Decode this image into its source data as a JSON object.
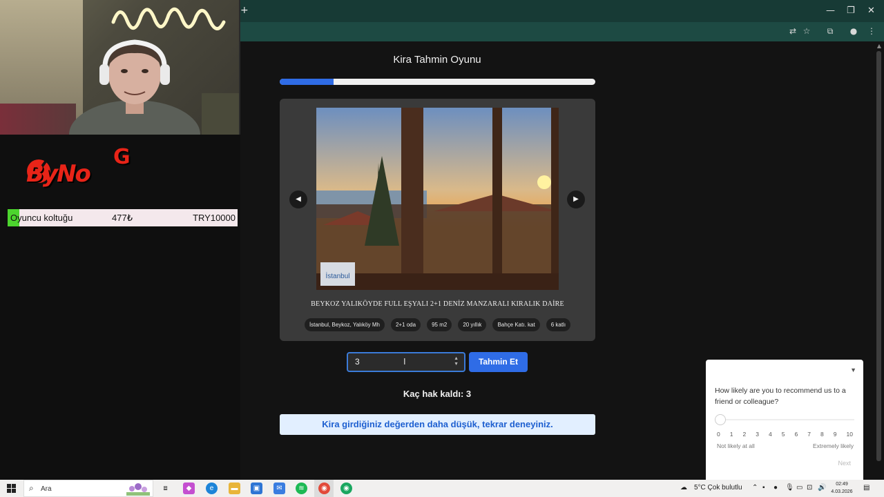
{
  "stream_overlay": {
    "logo_text": "ByNo",
    "logo_letter": "G",
    "donation": {
      "item": "Oyuncu koltuğu",
      "price": "477₺",
      "goal": "TRY10000"
    }
  },
  "game": {
    "title": "Kira Tahmin Oyunu",
    "progress_fraction": 0.17,
    "listing_title": "BEYKOZ YALIKÖYDE FULL EŞYALI 2+1 DENİZ MANZARALI KIRALIK DAİRE",
    "tags": [
      "İstanbul, Beykoz, Yalıköy Mh",
      "2+1 oda",
      "95 m2",
      "20 yıllık",
      "Bahçe Katı. kat",
      "6 katlı"
    ],
    "photo_badge": "İstanbul",
    "prev_icon": "play-left-icon",
    "next_icon": "play-right-icon",
    "guess_value": "3",
    "guess_button": "Tahmin Et",
    "remaining": "Kaç hak kaldı: 3",
    "feedback": "Kira girdiğiniz değerden daha düşük, tekrar deneyiniz."
  },
  "survey": {
    "question": "How likely are you to recommend us to a friend or colleague?",
    "scale": [
      "0",
      "1",
      "2",
      "3",
      "4",
      "5",
      "6",
      "7",
      "8",
      "9",
      "10"
    ],
    "low_label": "Not likely at all",
    "high_label": "Extremely likely",
    "next_label": "Next"
  },
  "taskbar": {
    "search_placeholder": "Ara",
    "weather": "5°C  Çok bulutlu",
    "time": "02:49",
    "date": "4.03.2026"
  },
  "colors": {
    "accent": "#2f6ce6",
    "titlebar": "#173a35",
    "feedback_bg": "#e2efff",
    "logo_red": "#e82418"
  }
}
